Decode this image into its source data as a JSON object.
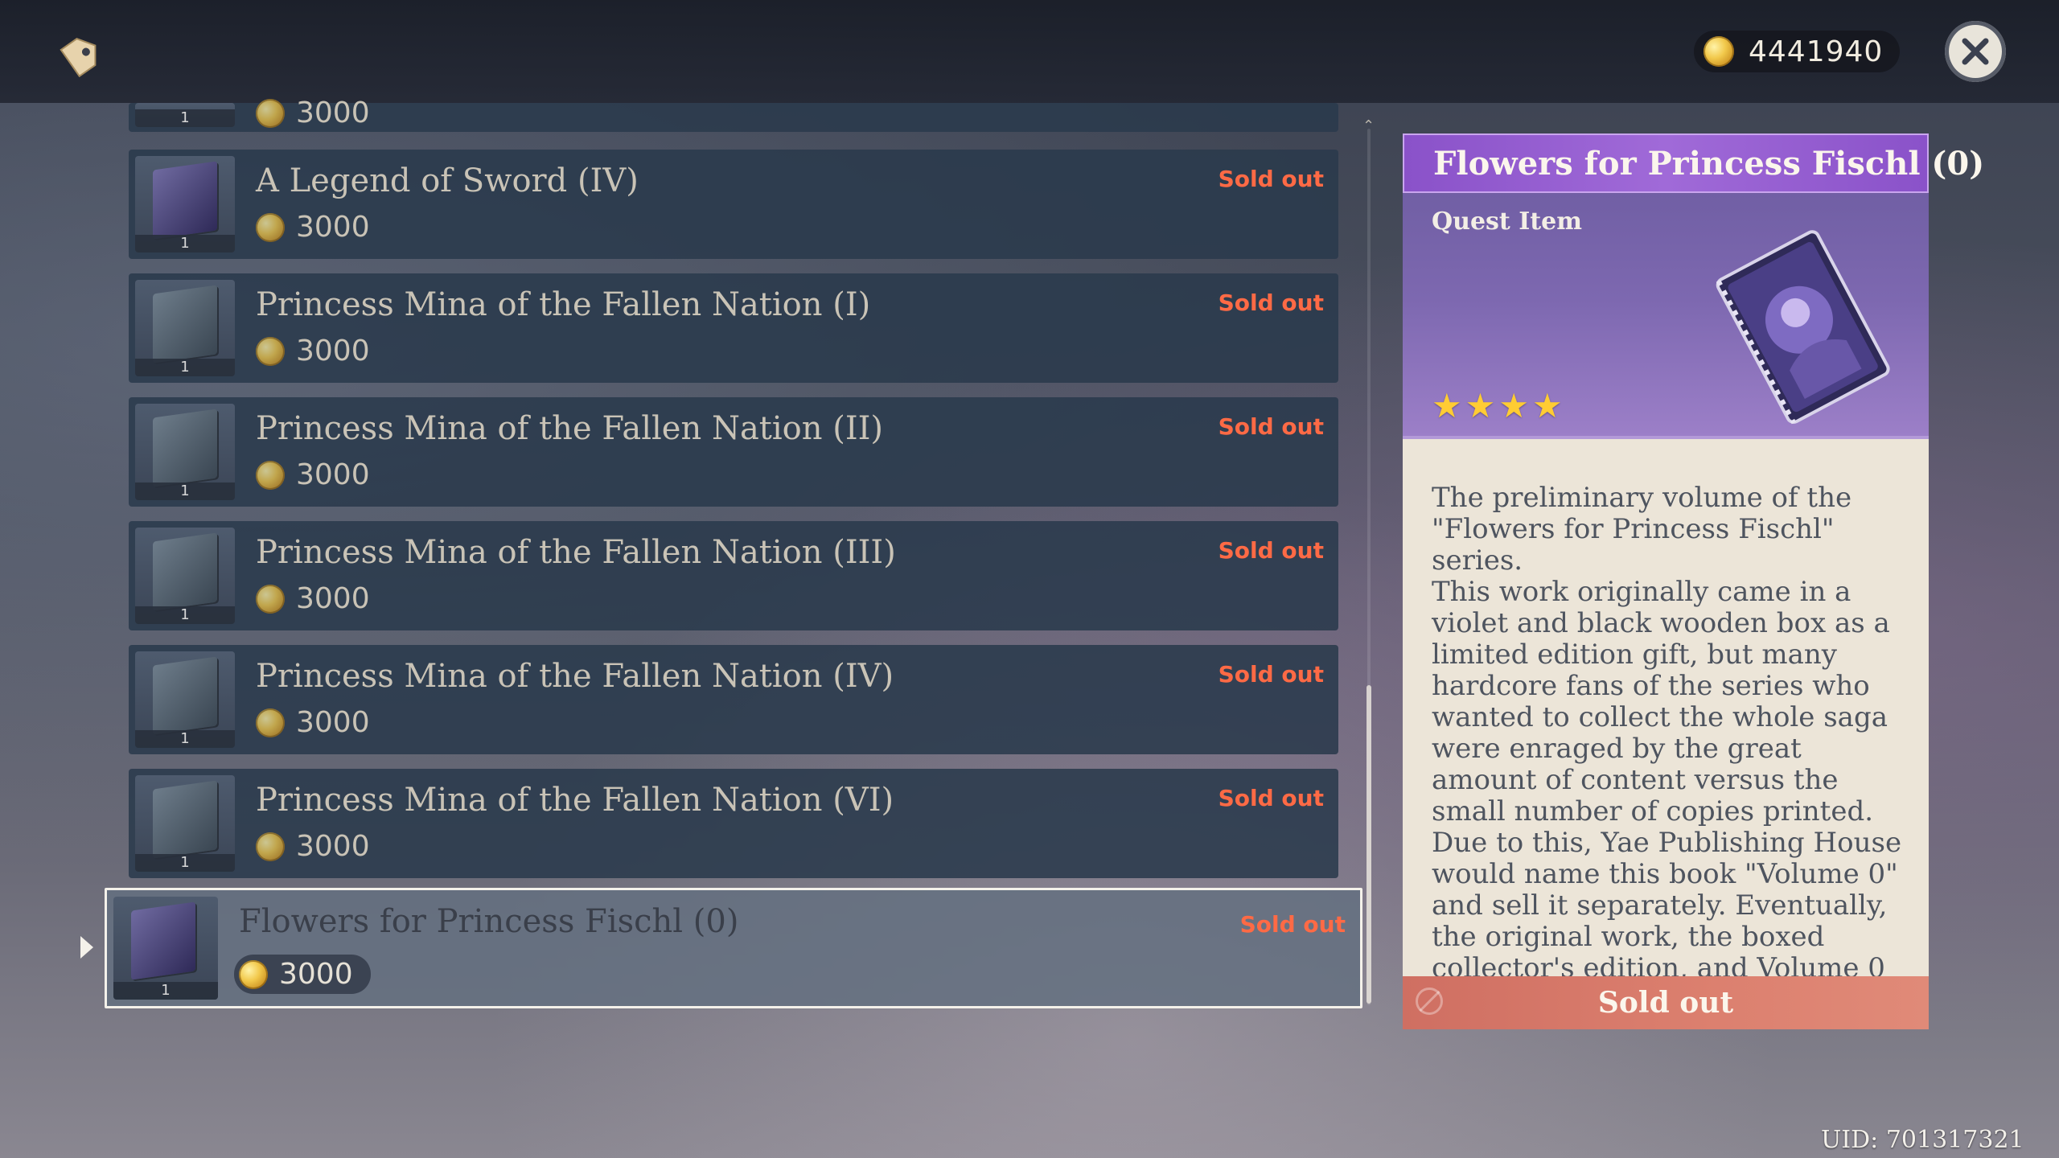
{
  "header": {
    "icon": "price-tag-icon",
    "currency_icon": "mora-coin-icon",
    "currency_amount": "4441940",
    "close_icon": "close-icon"
  },
  "items": [
    {
      "title": "",
      "count": "1",
      "price": "3000",
      "status": ""
    },
    {
      "title": "A Legend of Sword (IV)",
      "count": "1",
      "price": "3000",
      "status": "Sold out"
    },
    {
      "title": "Princess Mina of the Fallen Nation (I)",
      "count": "1",
      "price": "3000",
      "status": "Sold out"
    },
    {
      "title": "Princess Mina of the Fallen Nation (II)",
      "count": "1",
      "price": "3000",
      "status": "Sold out"
    },
    {
      "title": "Princess Mina of the Fallen Nation (III)",
      "count": "1",
      "price": "3000",
      "status": "Sold out"
    },
    {
      "title": "Princess Mina of the Fallen Nation (IV)",
      "count": "1",
      "price": "3000",
      "status": "Sold out"
    },
    {
      "title": "Princess Mina of the Fallen Nation (VI)",
      "count": "1",
      "price": "3000",
      "status": "Sold out"
    },
    {
      "title": "Flowers for Princess Fischl (0)",
      "count": "1",
      "price": "3000",
      "status": "Sold out"
    }
  ],
  "selected_index": 7,
  "detail": {
    "title": "Flowers for Princess Fischl (0)",
    "type": "Quest Item",
    "rarity": 4,
    "star_glyph": "★",
    "description": [
      "The preliminary volume of the \"Flowers for Princess Fischl\" series.",
      "This work originally came in a violet and black wooden box as a limited edition gift, but many hardcore fans of the series who wanted to collect the whole saga were enraged by the great amount of content versus the small number of copies printed.",
      "Due to this, Yae Publishing House would name this book \"Volume 0\" and sell it separately. Eventually, the original work, the boxed collector's edition, and Volume 0"
    ],
    "button_label": "Sold out"
  },
  "uid": "UID: 701317321",
  "colors": {
    "sold_out": "#ff6a45",
    "detail_header": "#8a52c9",
    "star": "#ffcc33",
    "footer": "#dc806f"
  }
}
